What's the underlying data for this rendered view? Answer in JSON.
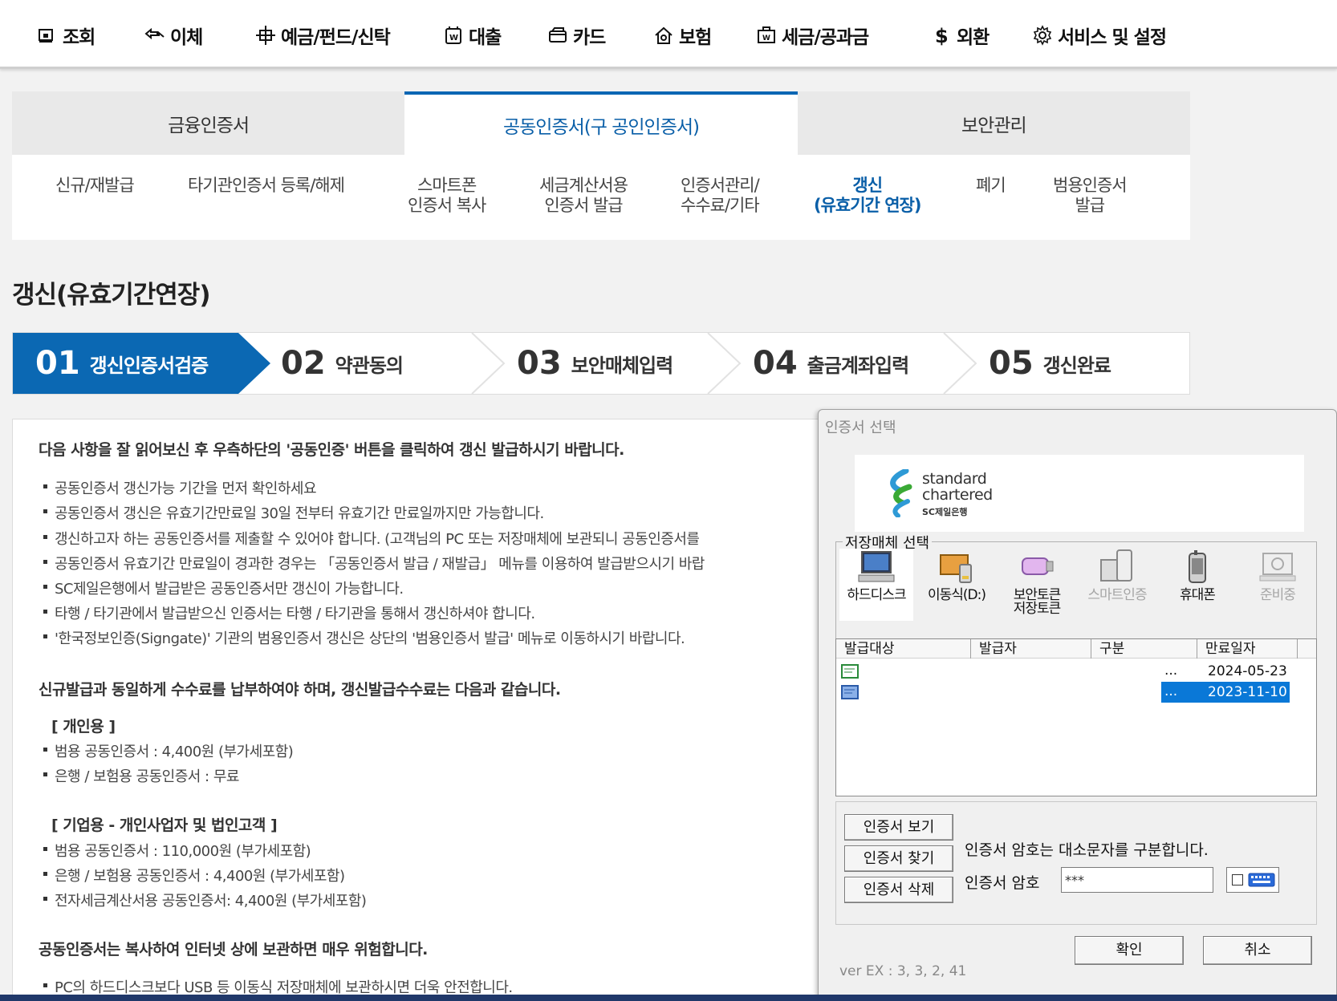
{
  "topnav": {
    "items": [
      {
        "label": "조회",
        "icon": "inquiry-icon"
      },
      {
        "label": "이체",
        "icon": "transfer-icon"
      },
      {
        "label": "예금/펀드/신탁",
        "icon": "deposit-icon"
      },
      {
        "label": "대출",
        "icon": "loan-icon"
      },
      {
        "label": "카드",
        "icon": "card-icon"
      },
      {
        "label": "보험",
        "icon": "insurance-icon"
      },
      {
        "label": "세금/공과금",
        "icon": "tax-icon"
      },
      {
        "label": "외환",
        "icon": "dollar-icon"
      },
      {
        "label": "서비스 및 설정",
        "icon": "gear-icon"
      }
    ]
  },
  "cert_tabs": [
    {
      "label": "금융인증서"
    },
    {
      "label": "공동인증서(구 공인인증서)",
      "active": true
    },
    {
      "label": "보안관리"
    }
  ],
  "subtabs": [
    {
      "label": "신규/재발급"
    },
    {
      "label": "타기관인증서 등록/해제"
    },
    {
      "label": "스마트폰\n인증서 복사"
    },
    {
      "label": "세금계산서용\n인증서 발급"
    },
    {
      "label": "인증서관리/\n수수료/기타"
    },
    {
      "label": "갱신\n(유효기간 연장)",
      "active": true
    },
    {
      "label": "폐기"
    },
    {
      "label": "범용인증서\n발급"
    }
  ],
  "page_title": "갱신(유효기간연장)",
  "steps": [
    {
      "num": "01",
      "label": "갱신인증서검증",
      "active": true
    },
    {
      "num": "02",
      "label": "약관동의"
    },
    {
      "num": "03",
      "label": "보안매체입력"
    },
    {
      "num": "04",
      "label": "출금계좌입력"
    },
    {
      "num": "05",
      "label": "갱신완료"
    }
  ],
  "content": {
    "intro": "다음 사항을 잘 읽어보신 후 우측하단의 '공동인증' 버튼을 클릭하여 갱신 발급하시기 바랍니다.",
    "bullets": [
      "공동인증서 갱신가능 기간을 먼저 확인하세요",
      "공동인증서 갱신은 유효기간만료일 30일 전부터 유효기간 만료일까지만 가능합니다.",
      "갱신하고자 하는 공동인증서를 제출할 수 있어야 합니다. (고객님의 PC 또는 저장매체에 보관되니 공동인증서를",
      "공동인증서 유효기간 만료일이 경과한 경우는 「공동인증서 발급 / 재발급」 메뉴를 이용하여 발급받으시기 바랍",
      "SC제일은행에서 발급받은 공동인증서만 갱신이 가능합니다.",
      "타행 / 타기관에서 발급받으신 인증서는 타행 / 타기관을 통해서 갱신하셔야 합니다.",
      "'한국정보인증(Signgate)' 기관의 범용인증서 갱신은 상단의 '범용인증서 발급' 메뉴로 이동하시기 바랍니다."
    ],
    "fee_heading": "신규발급과 동일하게 수수료를 납부하여야 하며, 갱신발급수수료는 다음과 같습니다.",
    "personal_heading": "[ 개인용 ]",
    "personal_items": [
      "범용 공동인증서 : 4,400원 (부가세포함)",
      "은행 / 보험용 공동인증서 : 무료"
    ],
    "business_heading": "[ 기업용 - 개인사업자 및 법인고객 ]",
    "business_items": [
      "범용 공동인증서 : 110,000원 (부가세포함)",
      "은행 / 보험용 공동인증서 : 4,400원 (부가세포함)",
      "전자세금계산서용 공동인증서: 4,400원 (부가세포함)"
    ],
    "warning_heading": "공동인증서는 복사하여 인터넷 상에 보관하면 매우 위험합니다.",
    "warning_items": [
      "PC의 하드디스크보다 USB 등 이동식 저장매체에 보관하시면 더욱 안전합니다."
    ]
  },
  "dialog": {
    "title": "인증서 선택",
    "brand_line1": "standard",
    "brand_line2": "chartered",
    "brand_line3": "SC제일은행",
    "storage_legend": "저장매체 선택",
    "media": [
      {
        "label": "하드디스크",
        "icon": "hard-disk-icon",
        "selected": true
      },
      {
        "label": "이동식(D:)",
        "icon": "removable-drive-icon"
      },
      {
        "label": "보안토큰\n저장토큰",
        "icon": "security-token-icon"
      },
      {
        "label": "스마트인증",
        "icon": "smart-auth-icon",
        "disabled": true
      },
      {
        "label": "휴대폰",
        "icon": "mobile-phone-icon"
      },
      {
        "label": "준비중",
        "icon": "preparing-icon",
        "disabled": true
      }
    ],
    "columns": [
      "발급대상",
      "발급자",
      "구분",
      "만료일자"
    ],
    "rows": [
      {
        "dots": "...",
        "expiry": "2024-05-23",
        "selected": false
      },
      {
        "dots": "...",
        "expiry": "2023-11-10",
        "selected": true
      }
    ],
    "btn_view": "인증서 보기",
    "btn_find": "인증서 찾기",
    "btn_delete": "인증서 삭제",
    "case_note": "인증서 암호는 대소문자를 구분합니다.",
    "pw_label": "인증서 암호",
    "pw_value": "***",
    "btn_ok": "확인",
    "btn_cancel": "취소",
    "version": "ver EX : 3, 3, 2, 41"
  }
}
